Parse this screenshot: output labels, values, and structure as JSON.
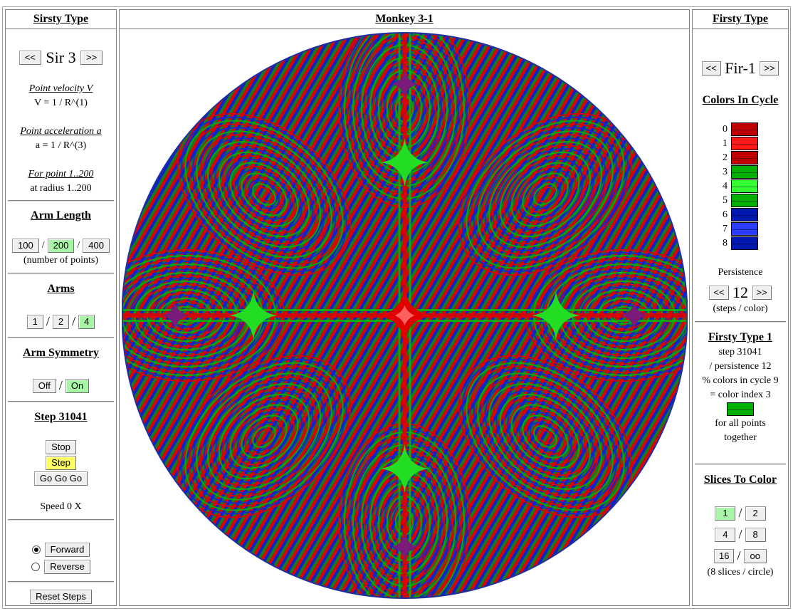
{
  "left": {
    "header": "Sirsty Type",
    "sir_prev": "<<",
    "sir_label": "Sir 3",
    "sir_next": ">>",
    "velocity_label": "Point velocity V",
    "velocity_formula": "V = 1 / R^(1)",
    "accel_label": "Point acceleration a",
    "accel_formula": "a = 1 / R^(3)",
    "points_label": "For point 1..200",
    "points_radius": "at radius 1..200",
    "arm_length_title": "Arm Length",
    "arm_length_options": [
      "100",
      "200",
      "400"
    ],
    "arm_length_selected": "200",
    "arm_length_note": "(number of points)",
    "arms_title": "Arms",
    "arms_options": [
      "1",
      "2",
      "4"
    ],
    "arms_selected": "4",
    "symmetry_title": "Arm Symmetry",
    "symmetry_off": "Off",
    "symmetry_on": "On",
    "symmetry_selected": "On",
    "step_title": "Step 31041",
    "stop_button": "Stop",
    "step_button": "Step",
    "gogogo_button": "Go Go Go",
    "speed": "Speed 0 X",
    "forward_button": "Forward",
    "reverse_button": "Reverse",
    "direction_selected": "Forward",
    "reset_button": "Reset Steps"
  },
  "center": {
    "header": "Monkey 3-1"
  },
  "right": {
    "header": "Firsty Type",
    "fir_prev": "<<",
    "fir_label": "Fir-1",
    "fir_next": ">>",
    "colors_title": "Colors In Cycle",
    "colors": [
      {
        "index": "0",
        "color": "#c00000"
      },
      {
        "index": "1",
        "color": "#ff1a1a"
      },
      {
        "index": "2",
        "color": "#c00000"
      },
      {
        "index": "3",
        "color": "#00b000"
      },
      {
        "index": "4",
        "color": "#33ff33"
      },
      {
        "index": "5",
        "color": "#00b000"
      },
      {
        "index": "6",
        "color": "#0018b0"
      },
      {
        "index": "7",
        "color": "#2a3cff"
      },
      {
        "index": "8",
        "color": "#0018b0"
      }
    ],
    "persistence_title": "Persistence",
    "persistence_prev": "<<",
    "persistence_value": "12",
    "persistence_next": ">>",
    "persistence_note": "(steps / color)",
    "firsty_title": "Firsty Type 1",
    "calc_step": "step 31041",
    "calc_persistence": "/ persistence 12",
    "calc_colors": "% colors in cycle 9",
    "calc_index": "= color index 3",
    "calc_color": "#00b000",
    "calc_all1": "for all points",
    "calc_all2": "together",
    "slices_title": "Slices To Color",
    "slices_options": [
      "1",
      "2",
      "4",
      "8",
      "16",
      "oo"
    ],
    "slices_selected": "1",
    "slices_note": "(8 slices / circle)"
  }
}
